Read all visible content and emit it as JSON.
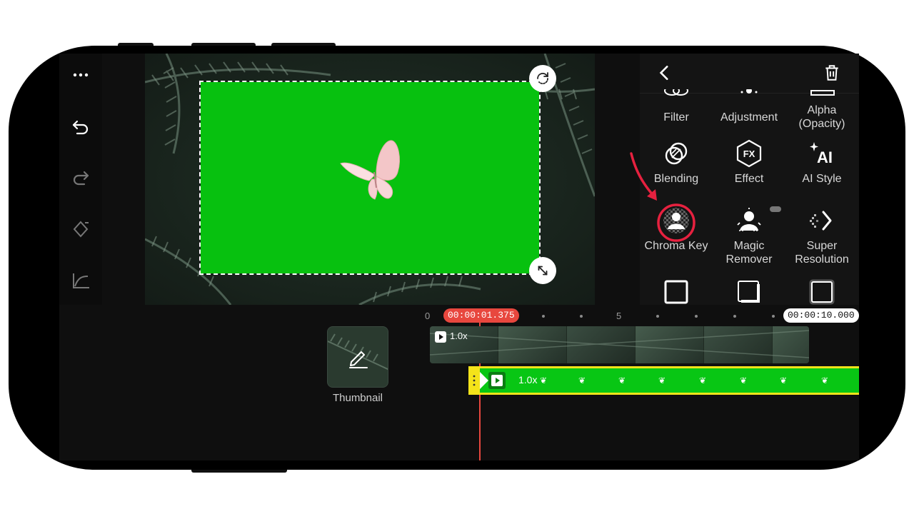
{
  "left_toolbar": {
    "icons": [
      "more-icon",
      "undo-icon",
      "redo-icon",
      "keyframe-icon",
      "curve-icon",
      "track-height-icon",
      "skip-start-icon",
      "skip-end-icon"
    ]
  },
  "panel": {
    "back_icon": "chevron-left-icon",
    "delete_icon": "trash-icon",
    "row1": [
      {
        "label": "Filter",
        "icon": "filter-icon"
      },
      {
        "label": "Adjustment",
        "icon": "adjustment-icon"
      },
      {
        "label_line1": "Alpha",
        "label_line2": "(Opacity)",
        "icon": "alpha-icon"
      }
    ],
    "row2": [
      {
        "label": "Blending",
        "icon": "blending-icon"
      },
      {
        "label": "Effect",
        "icon": "fx-icon",
        "icon_text": "FX"
      },
      {
        "label": "AI Style",
        "icon": "ai-style-icon",
        "icon_text": "AI"
      }
    ],
    "row3": [
      {
        "label": "Chroma Key",
        "icon": "chroma-key-icon",
        "highlighted": true
      },
      {
        "label_line1": "Magic",
        "label_line2": "Remover",
        "icon": "magic-remover-icon"
      },
      {
        "label_line1": "Super",
        "label_line2": "Resolution",
        "icon": "super-resolution-icon"
      }
    ],
    "row4_icons": [
      "square-icon",
      "shadow-square-icon",
      "glow-square-icon"
    ],
    "accent": "#e6213f"
  },
  "timeline": {
    "ruler": {
      "start": "0",
      "mid": "5"
    },
    "current_time": "00:00:01.375",
    "total_time": "00:00:10.000",
    "main_clip_speed": "1.0x",
    "overlay_clip_speed": "1.0x",
    "thumbnail_label": "Thumbnail",
    "colors": {
      "playhead": "#e8473e",
      "overlay": "#08c614",
      "selection": "#f4e31a"
    }
  }
}
